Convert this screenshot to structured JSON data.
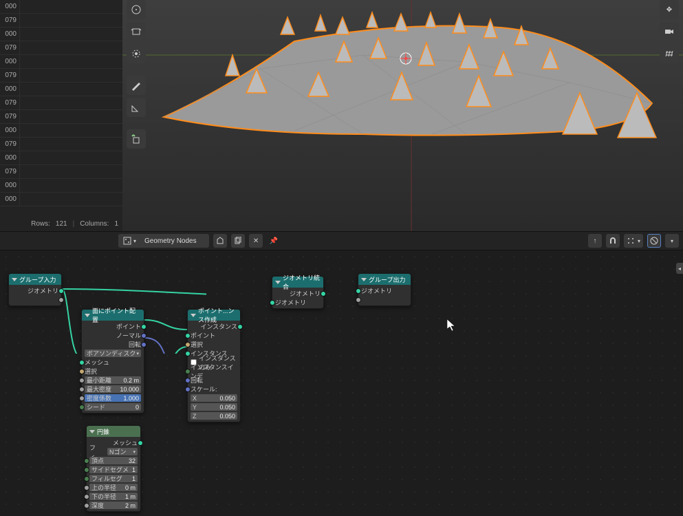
{
  "spreadsheet": {
    "rows": [
      "000",
      "079",
      "000",
      "079",
      "000",
      "079",
      "000",
      "079",
      "079",
      "000",
      "079",
      "000",
      "079",
      "000",
      "000"
    ],
    "status_rows_label": "Rows:",
    "status_rows_value": "121",
    "status_cols_label": "Columns:",
    "status_cols_value": "1"
  },
  "header": {
    "name": "Geometry Nodes"
  },
  "nodes": {
    "group_input": {
      "title": "グループ入力",
      "out_geom": "ジオメトリ"
    },
    "group_output": {
      "title": "グループ出力",
      "in_geom": "ジオメトリ"
    },
    "join_geom": {
      "title": "ジオメトリ統合",
      "out": "ジオメトリ",
      "in": "ジオメトリ"
    },
    "distribute": {
      "title": "面にポイント配置",
      "out_points": "ポイント",
      "out_normal": "ノーマル",
      "out_rotation": "回転",
      "method": "ボアソンディスク",
      "in_mesh": "メッシュ",
      "in_select": "選択",
      "dist_min_label": "最小距離",
      "dist_min_val": "0.2 m",
      "density_max_label": "最大密度",
      "density_max_val": "10.000",
      "factor_label": "密度係数",
      "factor_val": "1.000",
      "seed_label": "シード",
      "seed_val": "0"
    },
    "instance": {
      "title": "ポイント...ンス作成",
      "out": "インスタンス",
      "in_points": "ポイント",
      "in_select": "選択",
      "in_instance": "インスタンス",
      "in_pick": "インスタンスのみ",
      "in_index": "インスタンスインデ",
      "in_rotation": "回転",
      "scale_label": "スケール:",
      "x_label": "X",
      "x_val": "0.050",
      "y_label": "Y",
      "y_val": "0.050",
      "z_label": "Z",
      "z_val": "0.050"
    },
    "cone": {
      "title": "円錐",
      "out_mesh": "メッシュ",
      "fill_label": "フィ...",
      "fill_val": "Nゴン",
      "verts_label": "頂点",
      "verts_val": "32",
      "side_label": "サイドセグメ",
      "side_val": "1",
      "fill_seg_label": "フィルセグ",
      "fill_seg_val": "1",
      "r_top_label": "上の半径",
      "r_top_val": "0 m",
      "r_bot_label": "下の半径",
      "r_bot_val": "1 m",
      "depth_label": "深度",
      "depth_val": "2 m"
    }
  }
}
